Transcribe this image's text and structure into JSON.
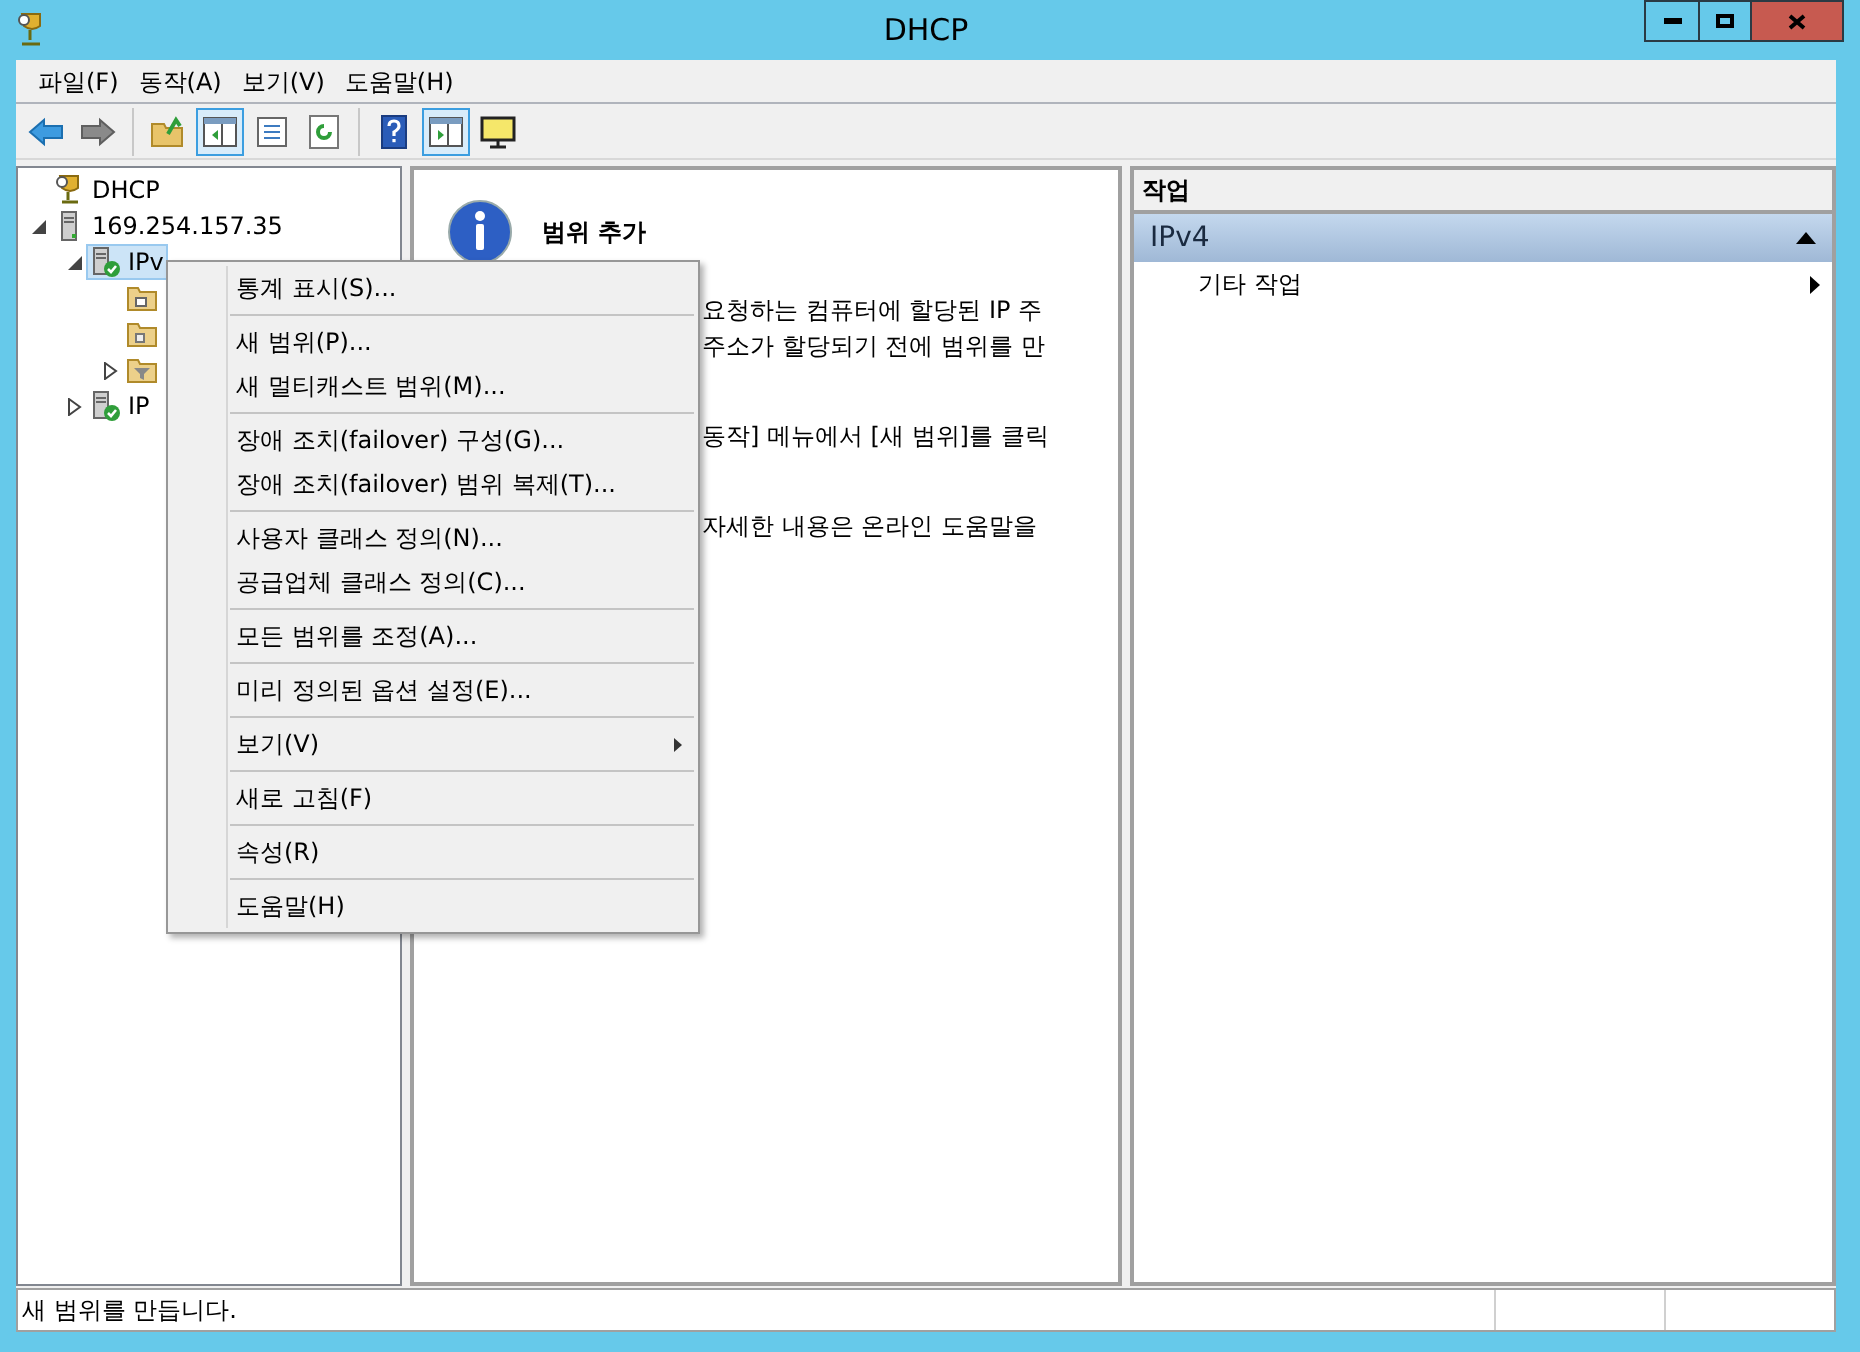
{
  "window": {
    "title": "DHCP"
  },
  "menu_bar": [
    "파일(F)",
    "동작(A)",
    "보기(V)",
    "도움말(H)"
  ],
  "toolbar": [
    [
      {
        "kind": "back",
        "pressed": false
      },
      {
        "kind": "forward",
        "pressed": false
      }
    ],
    [
      {
        "kind": "up",
        "pressed": false
      },
      {
        "kind": "tree",
        "pressed": true
      },
      {
        "kind": "export",
        "pressed": false
      },
      {
        "kind": "refresh",
        "pressed": false
      }
    ],
    [
      {
        "kind": "help",
        "pressed": false
      },
      {
        "kind": "actionpane",
        "pressed": true
      },
      {
        "kind": "monitor",
        "pressed": false
      }
    ]
  ],
  "tree": [
    {
      "label": "DHCP",
      "kind": "root",
      "selected": false
    },
    {
      "label": "169.254.157.35",
      "kind": "server",
      "selected": false,
      "expanded": true,
      "children": [
        {
          "label": "IPv",
          "kind": "protocol",
          "selected": true,
          "expanded": true,
          "children": [
            {
              "kind": "scope-folder",
              "selected": false
            },
            {
              "kind": "lock-folder",
              "selected": false
            },
            {
              "kind": "filter-folder",
              "selected": false,
              "expanded": false
            }
          ]
        },
        {
          "label": "IP",
          "kind": "protocol",
          "selected": false,
          "expanded": false
        }
      ]
    }
  ],
  "center": {
    "title": "범위 추가",
    "lines": [
      "요청하는 컴퓨터에 할당된 IP 주",
      "주소가 할당되기 전에 범위를 만",
      "동작] 메뉴에서 [새 범위]를 클릭",
      "자세한 내용은 온라인 도움말을"
    ]
  },
  "context_menu": [
    [
      {
        "label": "통계 표시(S)..."
      }
    ],
    [
      {
        "label": "새 범위(P)..."
      },
      {
        "label": "새 멀티캐스트 범위(M)..."
      }
    ],
    [
      {
        "label": "장애 조치(failover) 구성(G)..."
      },
      {
        "label": "장애 조치(failover) 범위 복제(T)..."
      }
    ],
    [
      {
        "label": "사용자 클래스 정의(N)..."
      },
      {
        "label": "공급업체 클래스 정의(C)..."
      }
    ],
    [
      {
        "label": "모든 범위를 조정(A)..."
      }
    ],
    [
      {
        "label": "미리 정의된 옵션 설정(E)..."
      }
    ],
    [
      {
        "label": "보기(V)",
        "submenu": true
      }
    ],
    [
      {
        "label": "새로 고침(F)"
      }
    ],
    [
      {
        "label": "속성(R)"
      }
    ],
    [
      {
        "label": "도움말(H)"
      }
    ]
  ],
  "actions": {
    "header": "작업",
    "section": {
      "title": "IPv4",
      "expanded": true,
      "items": [
        {
          "label": "기타 작업",
          "submenu": true
        }
      ]
    }
  },
  "status_bar": {
    "text": "새 범위를 만듭니다."
  }
}
